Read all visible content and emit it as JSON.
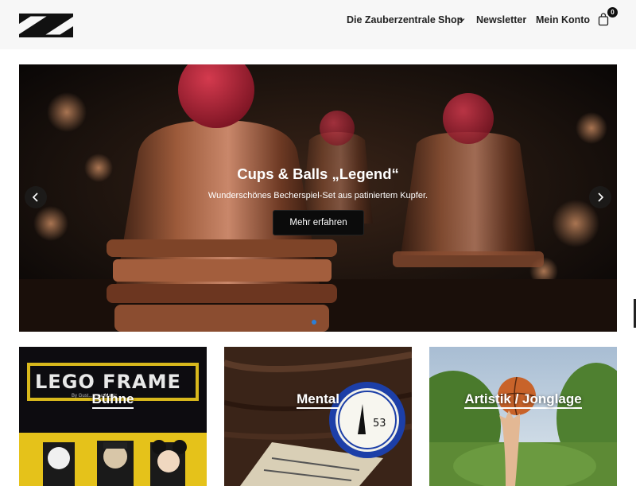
{
  "header": {
    "nav": [
      {
        "label": "Die Zauberzentrale"
      },
      {
        "label": "Shop"
      },
      {
        "label": "Newsletter"
      },
      {
        "label": "Mein Konto"
      }
    ],
    "cart_count": "0"
  },
  "hero": {
    "title": "Cups & Balls „Legend“",
    "subtitle": "Wunderschönes Becherspiel-Set aus patiniertem Kupfer.",
    "button": "Mehr erfahren",
    "slide_indicator_color": "#2b7fd8"
  },
  "tiles": [
    {
      "label": "Bühne",
      "image_text": "LEGO FRAME",
      "image_caption": "By Gust... ...ee Magic"
    },
    {
      "label": "Mental"
    },
    {
      "label": "Artistik / Jonglage"
    }
  ],
  "colors": {
    "accent": "#2b7fd8",
    "header_bg": "#f7f7f7",
    "button_bg": "#0b0b0b"
  }
}
